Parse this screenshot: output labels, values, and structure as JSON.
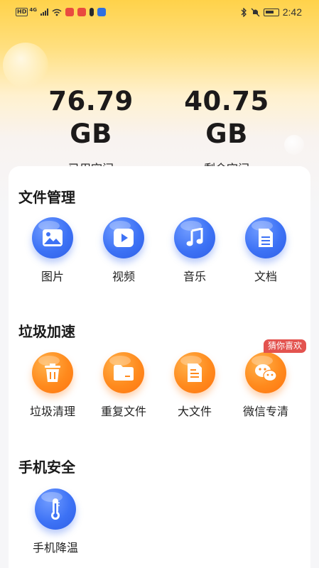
{
  "status_bar": {
    "left_badges": [
      "HD",
      "4G"
    ],
    "time": "2:42"
  },
  "storage": {
    "used_value": "76.79 GB",
    "used_label": "已用空间",
    "free_value": "40.75 GB",
    "free_label": "剩余空间"
  },
  "sections": {
    "file_management": {
      "title": "文件管理",
      "items": [
        {
          "label": "图片",
          "icon": "image-icon"
        },
        {
          "label": "视频",
          "icon": "video-play-icon"
        },
        {
          "label": "音乐",
          "icon": "music-note-icon"
        },
        {
          "label": "文档",
          "icon": "document-icon"
        }
      ]
    },
    "junk_cleanup": {
      "title": "垃圾加速",
      "items": [
        {
          "label": "垃圾清理",
          "icon": "trash-icon"
        },
        {
          "label": "重复文件",
          "icon": "folder-icon"
        },
        {
          "label": "大文件",
          "icon": "large-file-icon"
        },
        {
          "label": "微信专清",
          "icon": "wechat-icon",
          "badge": "猜你喜欢"
        }
      ]
    },
    "phone_security": {
      "title": "手机安全",
      "items": [
        {
          "label": "手机降温",
          "icon": "thermometer-icon"
        }
      ]
    }
  },
  "colors": {
    "blue_icon": "#3d72f5",
    "orange_icon": "#ff8a1d",
    "badge": "#e3534f",
    "hero_gradient_top": "#ffd24a"
  }
}
